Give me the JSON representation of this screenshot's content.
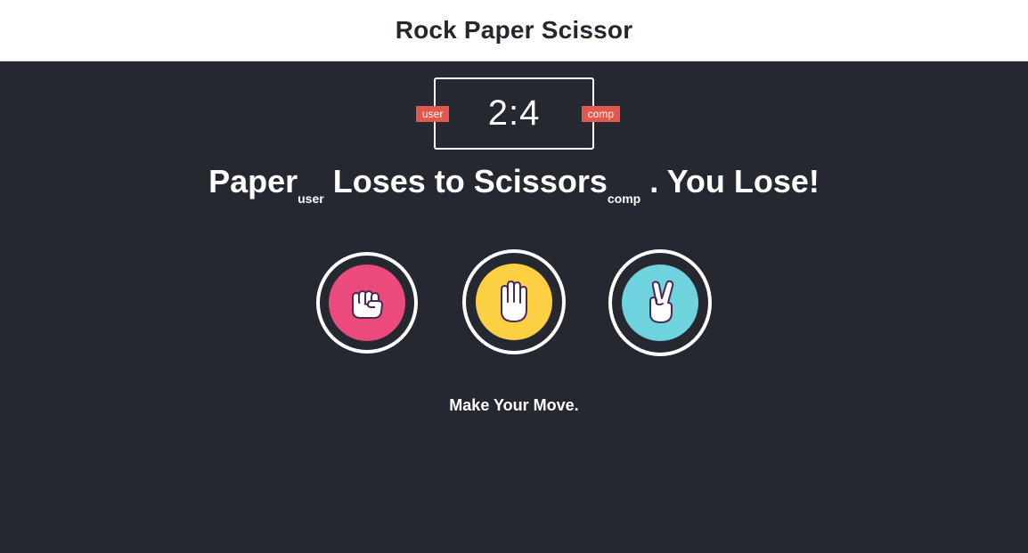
{
  "header": {
    "title": "Rock Paper Scissor"
  },
  "scoreboard": {
    "user_label": "user",
    "comp_label": "comp",
    "user_score": "2",
    "separator": ":",
    "comp_score": "4"
  },
  "result": {
    "user_choice": "Paper",
    "user_tag": "user",
    "verb": "Loses to",
    "comp_choice": "Scissors",
    "comp_tag": "comp",
    "outcome": ". You Lose!"
  },
  "choices": [
    {
      "name": "rock",
      "icon": "fist-icon",
      "color": "#eb4a7d"
    },
    {
      "name": "paper",
      "icon": "open-hand-icon",
      "color": "#fdcf43"
    },
    {
      "name": "scissors",
      "icon": "peace-sign-icon",
      "color": "#6fd3dd"
    }
  ],
  "prompt": "Make Your Move.",
  "colors": {
    "background": "#252831",
    "header_bg": "#ffffff",
    "badge": "#e2584d"
  }
}
